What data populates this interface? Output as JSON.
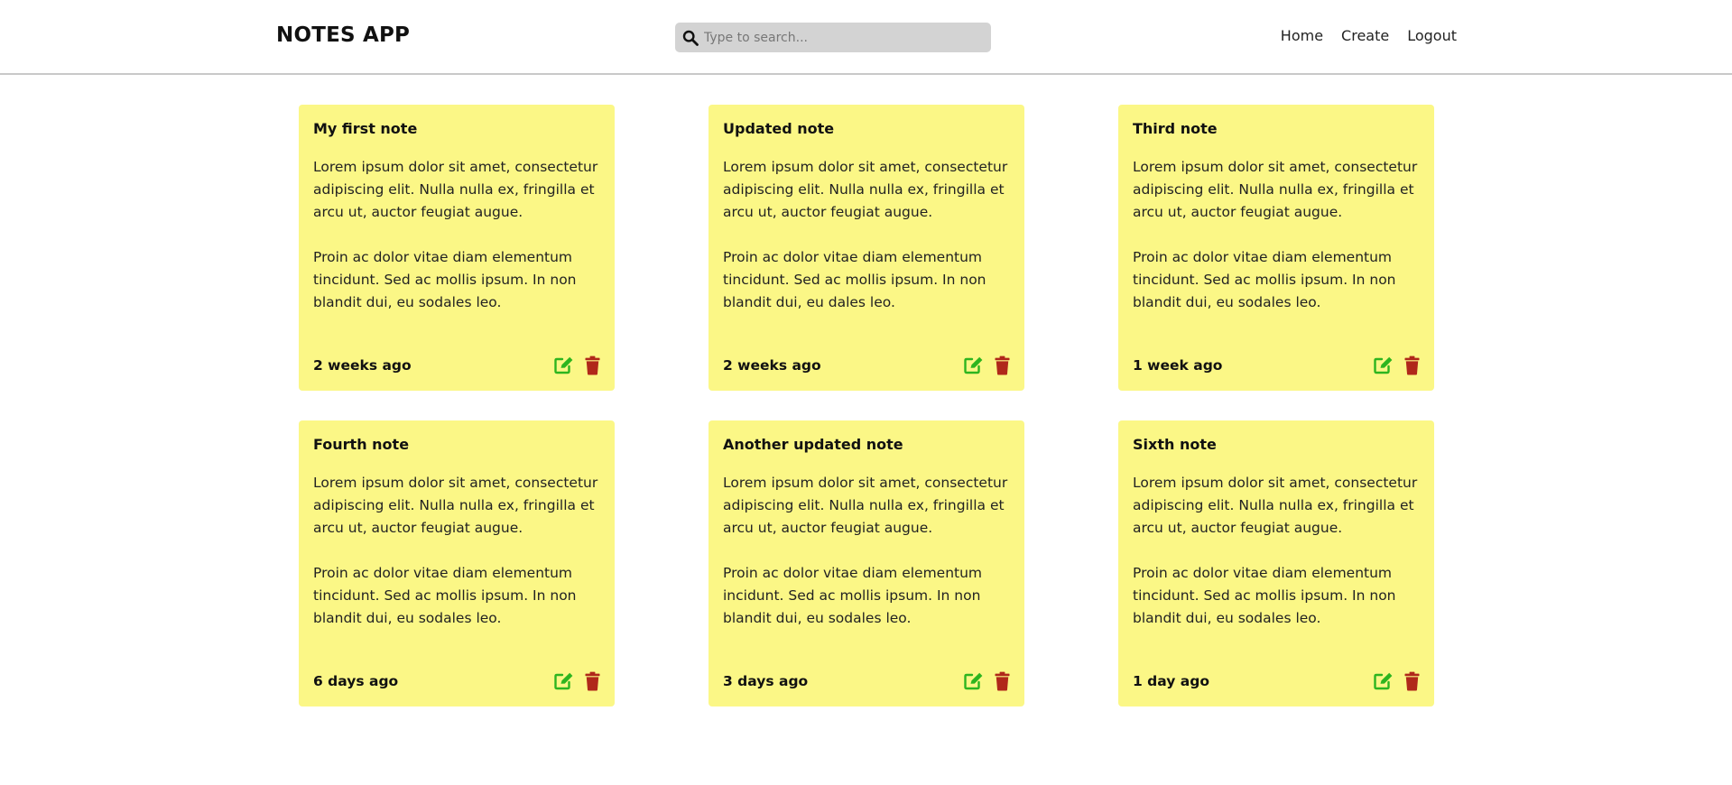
{
  "header": {
    "brand": "NOTES APP",
    "search_placeholder": "Type to search...",
    "nav": [
      {
        "label": "Home"
      },
      {
        "label": "Create"
      },
      {
        "label": "Logout"
      }
    ]
  },
  "colors": {
    "card_background": "#fbf786",
    "edit_icon": "#2db51f",
    "delete_icon": "#b0281a",
    "search_background": "#d3d3d3"
  },
  "icons": {
    "search": "search-icon",
    "edit": "edit-icon",
    "delete": "trash-icon"
  },
  "notes": [
    {
      "title": "My first note",
      "paragraphs": [
        "Lorem ipsum dolor sit amet, consectetur adipiscing elit. Nulla nulla ex, fringilla et arcu ut, auctor feugiat augue.",
        "Proin ac dolor vitae diam elementum tincidunt. Sed ac mollis ipsum. In non blandit dui, eu sodales leo."
      ],
      "date": "2 weeks ago"
    },
    {
      "title": "Updated note",
      "paragraphs": [
        "Lorem ipsum dolor sit amet, consectetur adipiscing elit. Nulla nulla ex, fringilla et arcu ut, auctor feugiat augue.",
        "Proin ac dolor vitae diam elementum tincidunt. Sed ac mollis ipsum. In non blandit dui, eu dales leo."
      ],
      "date": "2 weeks ago"
    },
    {
      "title": "Third note",
      "paragraphs": [
        "Lorem ipsum dolor sit amet, consectetur adipiscing elit. Nulla nulla ex, fringilla et arcu ut, auctor feugiat augue.",
        "Proin ac dolor vitae diam elementum tincidunt. Sed ac mollis ipsum. In non blandit dui, eu sodales leo."
      ],
      "date": "1 week ago"
    },
    {
      "title": "Fourth note",
      "paragraphs": [
        "Lorem ipsum dolor sit amet, consectetur adipiscing elit. Nulla nulla ex, fringilla et arcu ut, auctor feugiat augue.",
        "Proin ac dolor vitae diam elementum tincidunt. Sed ac mollis ipsum. In non blandit dui, eu sodales leo."
      ],
      "date": "6 days ago"
    },
    {
      "title": "Another updated note",
      "paragraphs": [
        "Lorem ipsum dolor sit amet, consectetur adipiscing elit. Nulla nulla ex, fringilla et arcu ut, auctor feugiat augue.",
        "Proin ac dolor vitae diam elementum incidunt. Sed ac mollis ipsum. In non blandit dui, eu sodales leo."
      ],
      "date": "3 days ago"
    },
    {
      "title": "Sixth note",
      "paragraphs": [
        "Lorem ipsum dolor sit amet, consectetur adipiscing elit. Nulla nulla ex, fringilla et arcu ut, auctor feugiat augue.",
        "Proin ac dolor vitae diam elementum tincidunt. Sed ac mollis ipsum. In non blandit dui, eu sodales leo."
      ],
      "date": "1 day ago"
    }
  ]
}
